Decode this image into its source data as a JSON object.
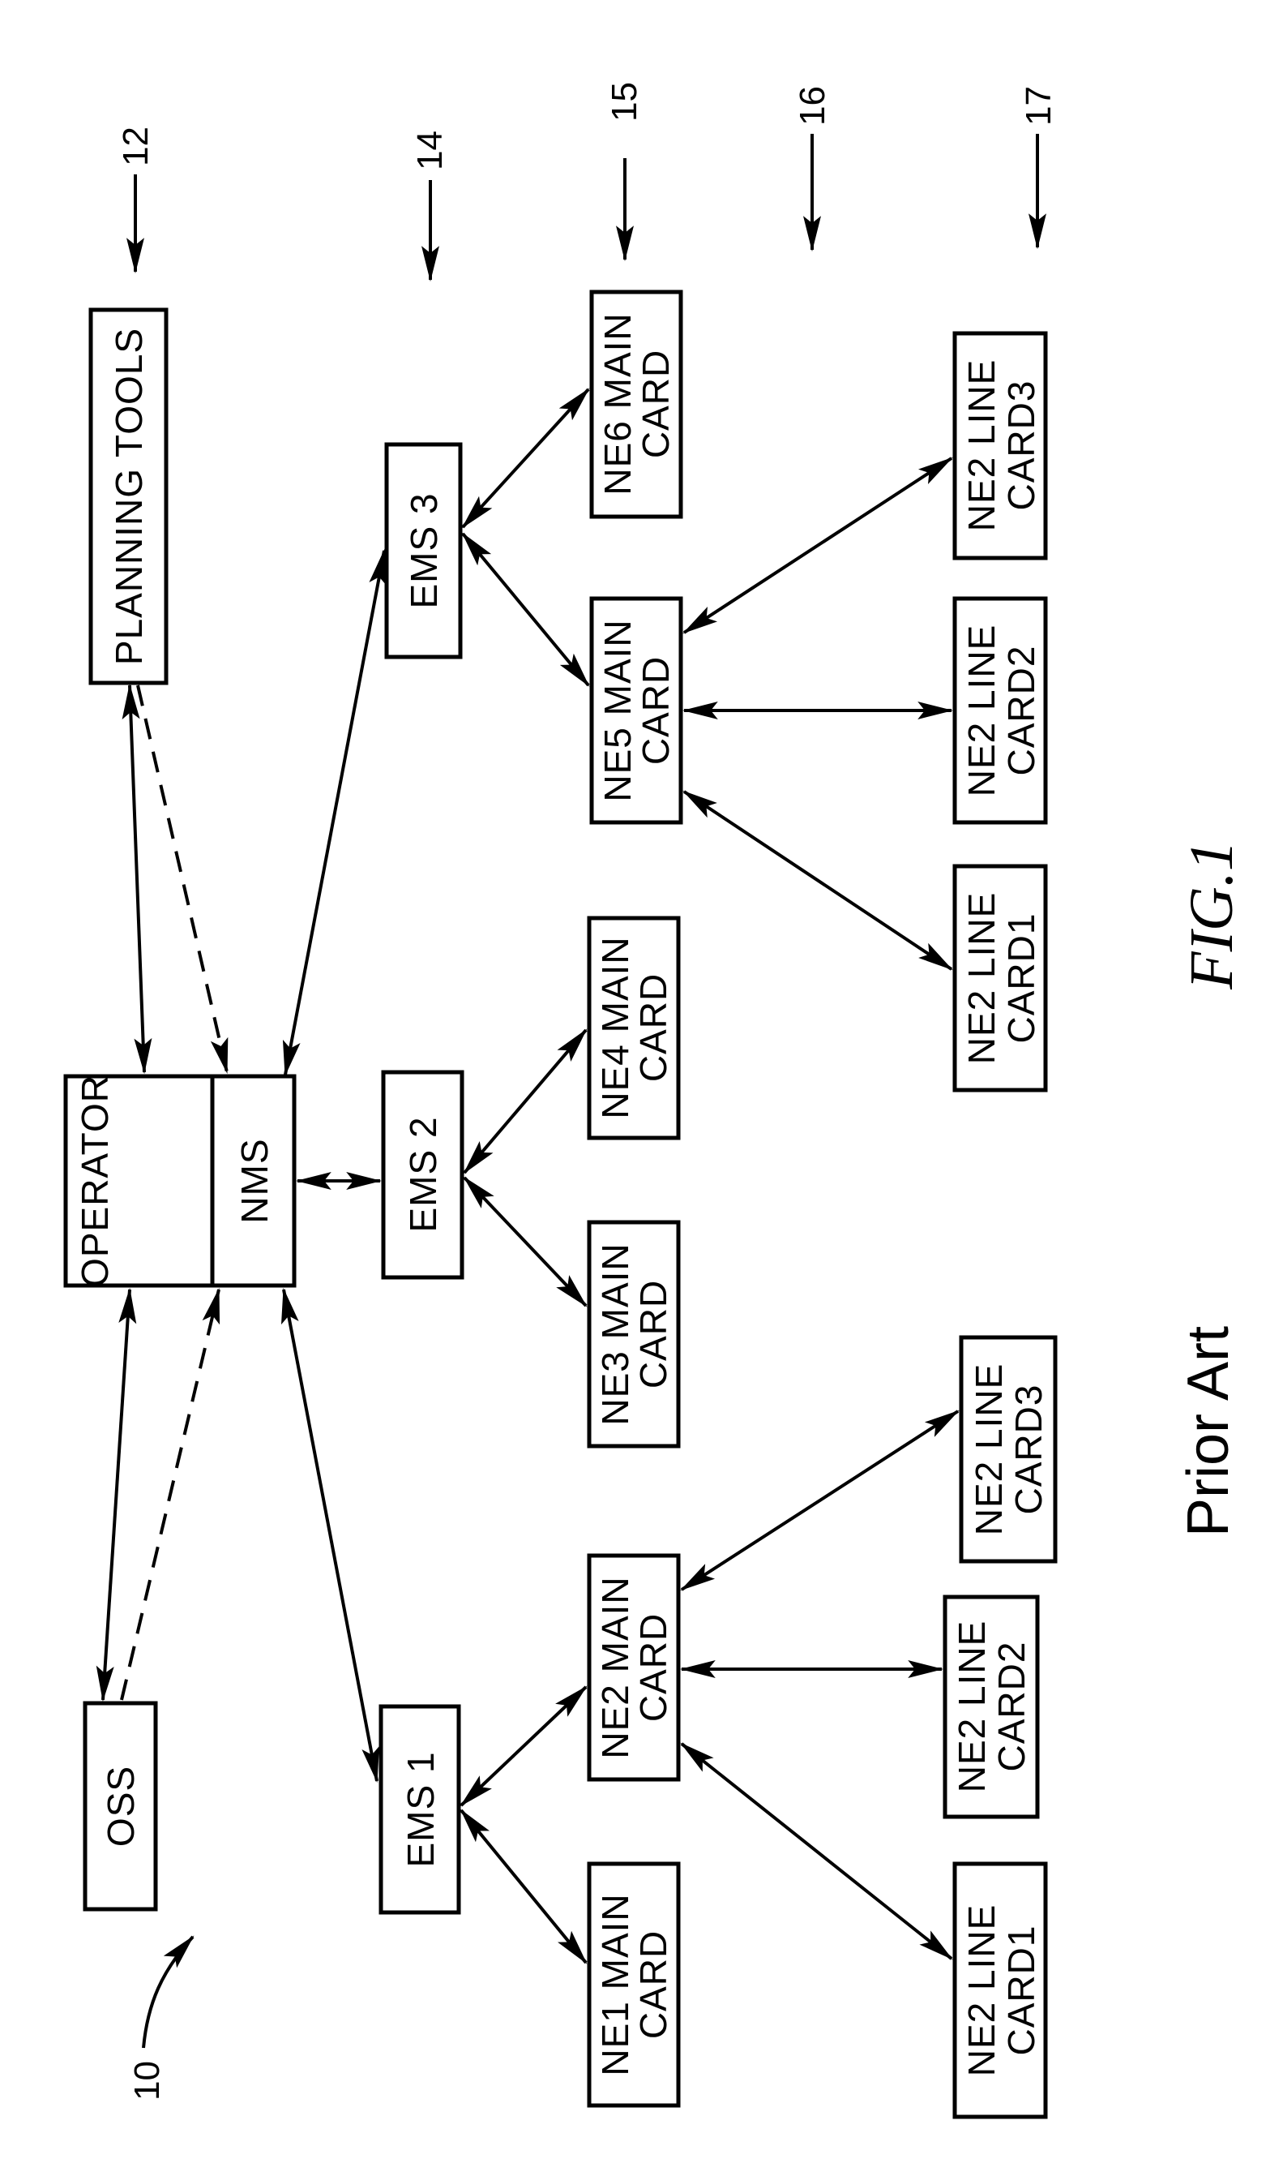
{
  "figure": {
    "caption_prefix": "Prior Art",
    "caption_fig": "FIG.1",
    "reference_numeral": "10"
  },
  "reference_labels": [
    {
      "id": "ref-12",
      "text": "12"
    },
    {
      "id": "ref-14",
      "text": "14"
    },
    {
      "id": "ref-15",
      "text": "15"
    },
    {
      "id": "ref-16",
      "text": "16"
    },
    {
      "id": "ref-17",
      "text": "17"
    }
  ],
  "nodes": {
    "planning_tools": {
      "lines": [
        "PLANNING TOOLS"
      ]
    },
    "operator": {
      "lines": [
        "OPERATOR"
      ]
    },
    "nms": {
      "lines": [
        "NMS"
      ]
    },
    "oss": {
      "lines": [
        "OSS"
      ]
    },
    "ems1": {
      "lines": [
        "EMS 1"
      ]
    },
    "ems2": {
      "lines": [
        "EMS 2"
      ]
    },
    "ems3": {
      "lines": [
        "EMS 3"
      ]
    },
    "ne1_main": {
      "lines": [
        "NE1 MAIN",
        "CARD"
      ]
    },
    "ne2_main": {
      "lines": [
        "NE2 MAIN",
        "CARD"
      ]
    },
    "ne3_main": {
      "lines": [
        "NE3 MAIN",
        "CARD"
      ]
    },
    "ne4_main": {
      "lines": [
        "NE4 MAIN",
        "CARD"
      ]
    },
    "ne5_main": {
      "lines": [
        "NE5 MAIN",
        "CARD"
      ]
    },
    "ne6_main": {
      "lines": [
        "NE6 MAIN",
        "CARD"
      ]
    },
    "ne2_lc1_bottom": {
      "lines": [
        "NE2 LINE",
        "CARD1"
      ]
    },
    "ne2_lc2_bottom": {
      "lines": [
        "NE2 LINE",
        "CARD2"
      ]
    },
    "ne2_lc3_bottom": {
      "lines": [
        "NE2 LINE",
        "CARD3"
      ]
    },
    "ne2_lc1_top": {
      "lines": [
        "NE2 LINE",
        "CARD1"
      ]
    },
    "ne2_lc2_top": {
      "lines": [
        "NE2 LINE",
        "CARD2"
      ]
    },
    "ne2_lc3_top": {
      "lines": [
        "NE2 LINE",
        "CARD3"
      ]
    }
  },
  "connections": [
    {
      "from": "planning_tools",
      "to": "operator",
      "style": "solid",
      "arrows": "both"
    },
    {
      "from": "planning_tools",
      "to": "nms",
      "style": "dashed",
      "arrows": "end"
    },
    {
      "from": "oss",
      "to": "operator",
      "style": "solid",
      "arrows": "both"
    },
    {
      "from": "oss",
      "to": "nms",
      "style": "dashed",
      "arrows": "end"
    },
    {
      "from": "operator",
      "to": "nms",
      "style": "solid",
      "arrows": "both"
    },
    {
      "from": "nms",
      "to": "ems1",
      "style": "solid",
      "arrows": "both"
    },
    {
      "from": "nms",
      "to": "ems2",
      "style": "solid",
      "arrows": "both"
    },
    {
      "from": "nms",
      "to": "ems3",
      "style": "solid",
      "arrows": "both"
    },
    {
      "from": "ems1",
      "to": "ne1_main",
      "style": "solid",
      "arrows": "both"
    },
    {
      "from": "ems1",
      "to": "ne2_main",
      "style": "solid",
      "arrows": "both"
    },
    {
      "from": "ems2",
      "to": "ne3_main",
      "style": "solid",
      "arrows": "both"
    },
    {
      "from": "ems2",
      "to": "ne4_main",
      "style": "solid",
      "arrows": "both"
    },
    {
      "from": "ems3",
      "to": "ne5_main",
      "style": "solid",
      "arrows": "both"
    },
    {
      "from": "ems3",
      "to": "ne6_main",
      "style": "solid",
      "arrows": "both"
    },
    {
      "from": "ne2_main",
      "to": "ne2_lc1_bottom",
      "style": "solid",
      "arrows": "both"
    },
    {
      "from": "ne2_main",
      "to": "ne2_lc2_bottom",
      "style": "solid",
      "arrows": "both"
    },
    {
      "from": "ne2_main",
      "to": "ne2_lc3_bottom",
      "style": "solid",
      "arrows": "both"
    },
    {
      "from": "ne5_main",
      "to": "ne2_lc1_top",
      "style": "solid",
      "arrows": "both"
    },
    {
      "from": "ne5_main",
      "to": "ne2_lc2_top",
      "style": "solid",
      "arrows": "both"
    },
    {
      "from": "ne5_main",
      "to": "ne2_lc3_top",
      "style": "solid",
      "arrows": "both"
    }
  ]
}
